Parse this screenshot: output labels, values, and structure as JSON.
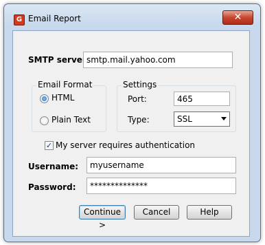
{
  "window": {
    "title": "Email Report",
    "app_icon": "G",
    "close_symbol": "✕"
  },
  "smtp": {
    "label": "SMTP server:",
    "value": "smtp.mail.yahoo.com"
  },
  "email_format": {
    "title": "Email Format",
    "options": [
      {
        "label": "HTML",
        "checked": true
      },
      {
        "label": "Plain Text",
        "checked": false
      }
    ]
  },
  "settings": {
    "title": "Settings",
    "port_label": "Port:",
    "port_value": "465",
    "type_label": "Type:",
    "type_value": "SSL"
  },
  "auth": {
    "label": "My server requires authentication",
    "checked": true,
    "check_mark": "✓"
  },
  "username": {
    "label": "Username:",
    "value": "myusername"
  },
  "password": {
    "label": "Password:",
    "value": "**************"
  },
  "buttons": {
    "continue": "Continue >",
    "cancel": "Cancel",
    "help": "Help"
  }
}
